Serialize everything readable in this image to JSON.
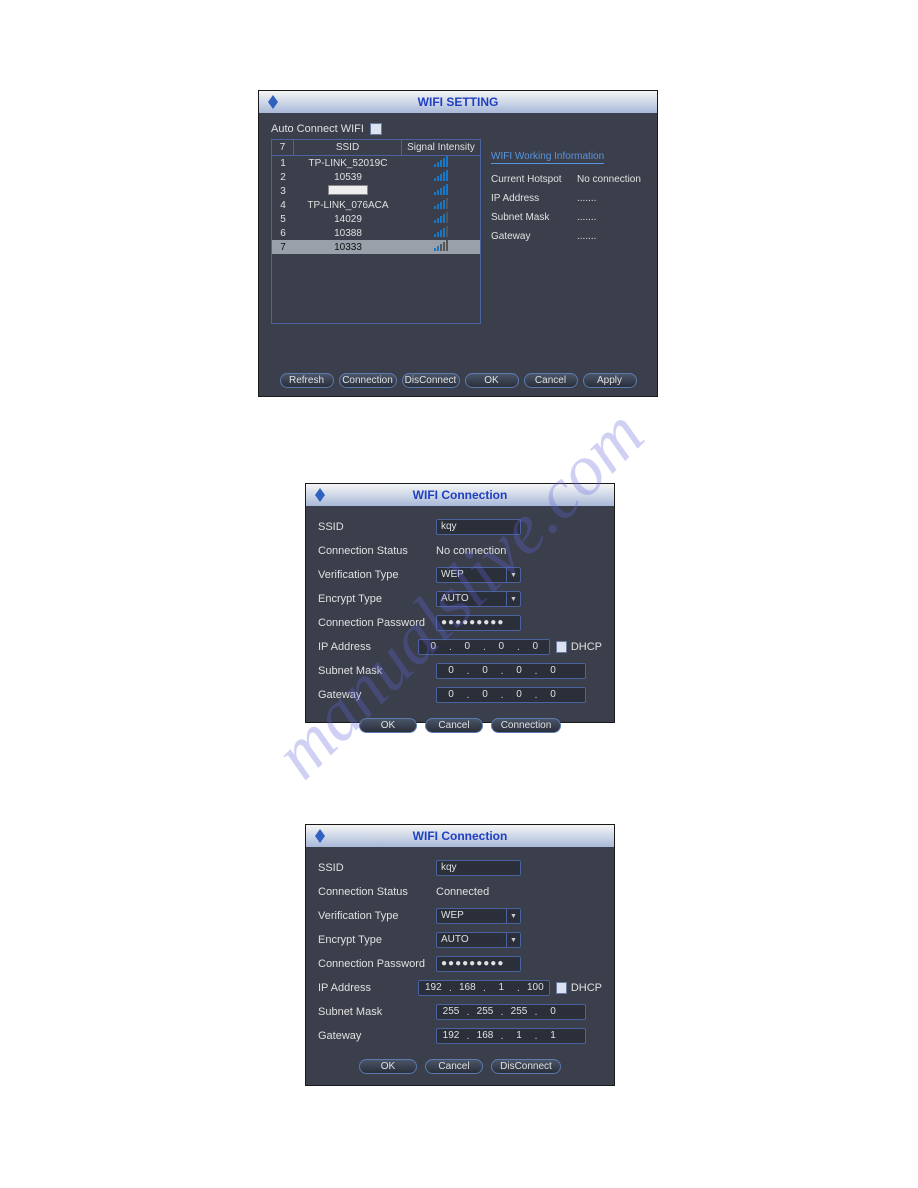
{
  "watermark": "manualslive.com",
  "window1": {
    "title": "WIFI SETTING",
    "auto_connect_label": "Auto Connect WIFI",
    "auto_connect_checked": false,
    "table": {
      "headers": {
        "idx": "7",
        "ssid": "SSID",
        "signal": "Signal Intensity"
      },
      "rows": [
        {
          "idx": "1",
          "ssid": "TP-LINK_52019C",
          "bars": 5,
          "selected": false
        },
        {
          "idx": "2",
          "ssid": "10539",
          "bars": 5,
          "selected": false
        },
        {
          "idx": "3",
          "ssid": "",
          "bars": 5,
          "selected": false,
          "blank": true
        },
        {
          "idx": "4",
          "ssid": "TP-LINK_076ACA",
          "bars": 4,
          "selected": false
        },
        {
          "idx": "5",
          "ssid": "14029",
          "bars": 4,
          "selected": false
        },
        {
          "idx": "6",
          "ssid": "10388",
          "bars": 4,
          "selected": false
        },
        {
          "idx": "7",
          "ssid": "10333",
          "bars": 2,
          "selected": true
        }
      ]
    },
    "info": {
      "title": "WIFI Working Information",
      "current_hotspot_label": "Current Hotspot",
      "current_hotspot_value": "No connection",
      "ip_label": "IP Address",
      "ip_value": ".......",
      "mask_label": "Subnet Mask",
      "mask_value": ".......",
      "gw_label": "Gateway",
      "gw_value": "......."
    },
    "buttons": {
      "refresh": "Refresh",
      "connection": "Connection",
      "disconnect": "DisConnect",
      "ok": "OK",
      "cancel": "Cancel",
      "apply": "Apply"
    }
  },
  "window2": {
    "title": "WIFI Connection",
    "labels": {
      "ssid": "SSID",
      "status": "Connection Status",
      "verify": "Verification Type",
      "encrypt": "Encrypt Type",
      "pwd": "Connection Password",
      "ip": "IP Address",
      "mask": "Subnet Mask",
      "gw": "Gateway",
      "dhcp": "DHCP"
    },
    "values": {
      "ssid": "kqy",
      "status": "No connection",
      "verify": "WEP",
      "encrypt": "AUTO",
      "pwd": "●●●●●●●●●",
      "ip": [
        "0",
        "0",
        "0",
        "0"
      ],
      "mask": [
        "0",
        "0",
        "0",
        "0"
      ],
      "gw": [
        "0",
        "0",
        "0",
        "0"
      ],
      "dhcp_checked": false
    },
    "buttons": {
      "ok": "OK",
      "cancel": "Cancel",
      "connection": "Connection"
    }
  },
  "window3": {
    "title": "WIFI Connection",
    "labels": {
      "ssid": "SSID",
      "status": "Connection Status",
      "verify": "Verification Type",
      "encrypt": "Encrypt Type",
      "pwd": "Connection Password",
      "ip": "IP Address",
      "mask": "Subnet Mask",
      "gw": "Gateway",
      "dhcp": "DHCP"
    },
    "values": {
      "ssid": "kqy",
      "status": "Connected",
      "verify": "WEP",
      "encrypt": "AUTO",
      "pwd": "●●●●●●●●●",
      "ip": [
        "192",
        "168",
        "1",
        "100"
      ],
      "mask": [
        "255",
        "255",
        "255",
        "0"
      ],
      "gw": [
        "192",
        "168",
        "1",
        "1"
      ],
      "dhcp_checked": false
    },
    "buttons": {
      "ok": "OK",
      "cancel": "Cancel",
      "disconnect": "DisConnect"
    }
  }
}
